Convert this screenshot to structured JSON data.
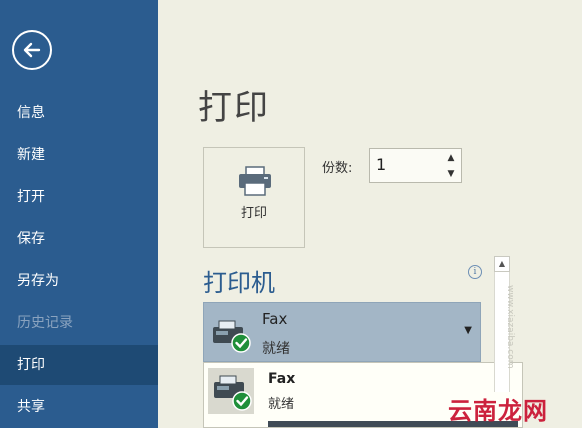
{
  "sidebar": {
    "items": [
      {
        "label": "信息",
        "state": "normal"
      },
      {
        "label": "新建",
        "state": "normal"
      },
      {
        "label": "打开",
        "state": "normal"
      },
      {
        "label": "保存",
        "state": "normal"
      },
      {
        "label": "另存为",
        "state": "normal"
      },
      {
        "label": "历史记录",
        "state": "disabled"
      },
      {
        "label": "打印",
        "state": "active"
      },
      {
        "label": "共享",
        "state": "normal"
      }
    ],
    "colors": {
      "background": "#2b5c8f",
      "active": "#1e4a74"
    }
  },
  "main": {
    "title": "打印",
    "print_button_label": "打印",
    "copies": {
      "label": "份数:",
      "value": "1"
    },
    "printer_section": {
      "heading": "打印机",
      "selected": {
        "name": "Fax",
        "status": "就绪"
      },
      "dropdown_items": [
        {
          "name": "Fax",
          "status": "就绪"
        }
      ]
    }
  },
  "watermark": {
    "text": "云南龙网",
    "url": "www.xiazaiba.com"
  },
  "icons": [
    "back-arrow-icon",
    "printer-icon",
    "fax-icon",
    "ready-check-icon",
    "info-icon",
    "chevron-down-icon",
    "spin-up-icon",
    "spin-down-icon"
  ]
}
